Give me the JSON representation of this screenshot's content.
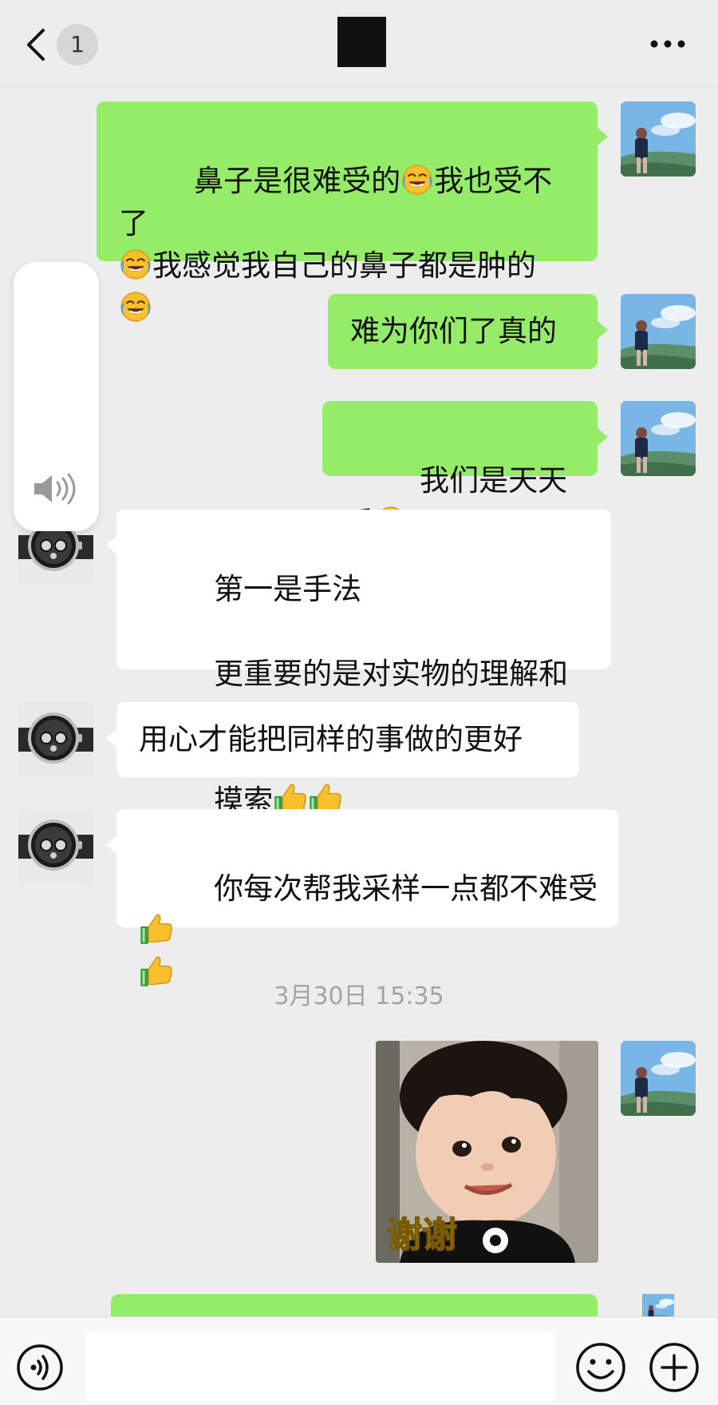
{
  "header": {
    "unread_count": "1",
    "title_redacted": "",
    "back_icon": "chevron-left-icon",
    "more_icon": "more-dots-icon"
  },
  "messages": [
    {
      "side": "right",
      "segments": [
        "鼻子是很难受的",
        "我也受不了",
        "我感觉我自己的鼻子都是肿的"
      ],
      "emoji": "laugh-cry-emoji"
    },
    {
      "side": "right",
      "text": "难为你们了真的"
    },
    {
      "side": "right",
      "text": "我们是天天采",
      "emoji": "laugh-cry-emoji"
    },
    {
      "side": "left",
      "line1": "第一是手法",
      "line2": "更重要的是对实物的理解和用心",
      "line3": "摸索",
      "emoji": "thumbs-up-emoji"
    },
    {
      "side": "left",
      "text": "用心才能把同样的事做的更好"
    },
    {
      "side": "left",
      "text": "你每次帮我采样一点都不难受",
      "emoji": "thumbs-up-emoji"
    }
  ],
  "timestamp": "3月30日 15:35",
  "sticker": {
    "caption": "谢谢"
  },
  "footer": {
    "input_placeholder": "",
    "voice_icon": "voice-wave-icon",
    "emoji_icon": "smiley-icon",
    "plus_icon": "plus-circle-icon"
  },
  "colors": {
    "background": "#ededed",
    "sent_bubble": "#95ec69",
    "received_bubble": "#ffffff",
    "timestamp_text": "#a3a3a3"
  }
}
